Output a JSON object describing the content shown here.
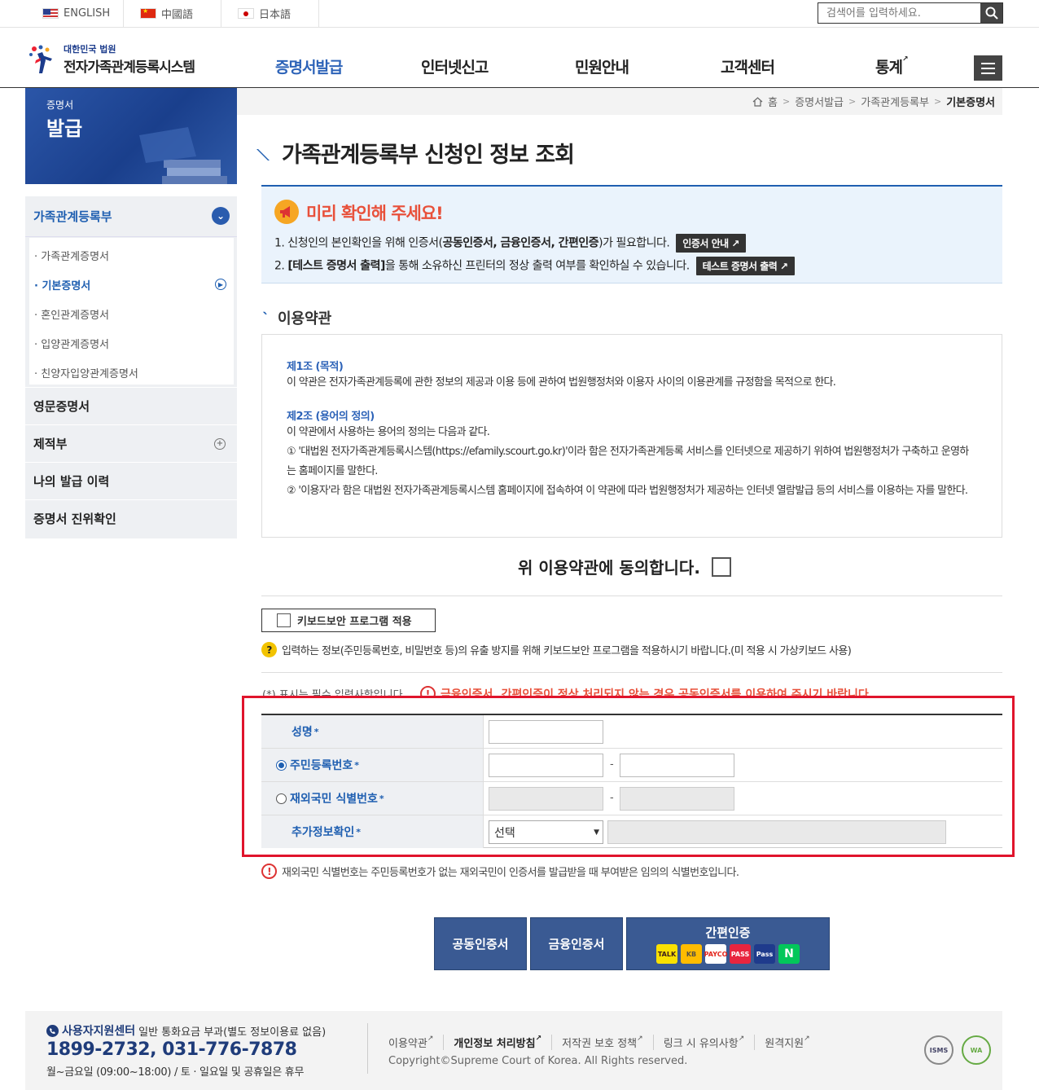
{
  "topbar": {
    "languages": [
      {
        "label": "ENGLISH",
        "flag": "us-flag-icon"
      },
      {
        "label": "中國語",
        "flag": "cn-flag-icon"
      },
      {
        "label": "日本語",
        "flag": "jp-flag-icon"
      }
    ],
    "search_placeholder": "검색어를 입력하세요."
  },
  "header": {
    "logo_sub": "대한민국 법원",
    "logo_main": "전자가족관계등록시스템",
    "nav": [
      "증명서발급",
      "인터넷신고",
      "민원안내",
      "고객센터",
      "통계"
    ],
    "active_nav": "증명서발급"
  },
  "lnb": {
    "banner_small": "증명서",
    "banner_big": "발급",
    "section": "가족관계등록부",
    "sub_items": [
      "가족관계증명서",
      "기본증명서",
      "혼인관계증명서",
      "입양관계증명서",
      "친양자입양관계증명서"
    ],
    "active_sub": "기본증명서",
    "menus": [
      "영문증명서",
      "제적부",
      "나의 발급 이력",
      "증명서 진위확인"
    ]
  },
  "breadcrumb": [
    "홈",
    "증명서발급",
    "가족관계등록부",
    "기본증명서"
  ],
  "page_title": "가족관계등록부 신청인 정보 조회",
  "notice": {
    "title": "미리 확인해 주세요!",
    "line1_pre": "1. 신청인의 본인확인을 위해 인증서(",
    "line1_bold": "공동인증서, 금융인증서, 간편인증",
    "line1_post": ")가 필요합니다.",
    "line1_btn": "인증서 안내",
    "line2_pre": "2. ",
    "line2_bold": "[테스트 증명서 출력]",
    "line2_post": "을 통해 소유하신 프린터의 정상 출력 여부를 확인하실 수 있습니다.",
    "line2_btn": "테스트 증명서 출력"
  },
  "terms": {
    "heading": "이용약관",
    "art1_title": "제1조 (목적)",
    "art1_body": "이 약관은 전자가족관계등록에 관한 정보의 제공과 이용 등에 관하여 법원행정처와 이용자 사이의 이용관계를 규정함을 목적으로 한다.",
    "art2_title": "제2조 (용어의 정의)",
    "art2_intro": "이 약관에서 사용하는 용어의 정의는 다음과 같다.",
    "art2_item1": "① '대법원 전자가족관계등록시스템(https://efamily.scourt.go.kr)'이라 함은 전자가족관계등록 서비스를 인터넷으로 제공하기 위하여 법원행정처가 구축하고 운영하는 홈페이지를 말한다.",
    "art2_item2": "② '이용자'라 함은 대법원 전자가족관계등록시스템 홈페이지에 접속하여 이 약관에 따라 법원행정처가 제공하는 인터넷 열람발급 등의 서비스를 이용하는 자를 말한다.",
    "agree_label": "위 이용약관에 동의합니다."
  },
  "keyboard": {
    "button_label": "키보드보안 프로그램 적용",
    "note": "입력하는 정보(주민등록번호, 비밀번호 등)의 유출 방지를 위해 키보드보안 프로그램을 적용하시기 바랍니다.(미 적용 시 가상키보드 사용)"
  },
  "form": {
    "required_note": "(*) 표시는 필수 입력사항입니다.",
    "warning": "금융인증서, 간편인증이 정상 처리되지 않는 경우 공동인증서를 이용하여 주시기 바랍니다.",
    "name_label": "성명",
    "rrn_label": "주민등록번호",
    "foreign_label": "재외국민 식별번호",
    "extra_label": "추가정보확인",
    "star": "*",
    "dash": "-",
    "select_value": "선택",
    "foreign_note": "재외국민 식별번호는 주민등록번호가 없는 재외국민이 인증서를 발급받을 때 부여받은 임의의 식별번호입니다."
  },
  "auth": {
    "joint": "공동인증서",
    "financial": "금융인증서",
    "easy": "간편인증",
    "easy_icons": [
      "TALK",
      "KB",
      "PAYCO",
      "PASS",
      "Pass",
      "N"
    ]
  },
  "footer": {
    "center": "사용자지원센터",
    "center_note": "일반 통화요금 부과(별도 정보이용료 없음)",
    "phone": "1899-2732, 031-776-7878",
    "hours": "월~금요일 (09:00~18:00) / 토 · 일요일 및 공휴일은 휴무",
    "links": [
      "이용약관",
      "개인정보 처리방침",
      "저작권 보호 정책",
      "링크 시 유의사항",
      "원격지원"
    ],
    "copyright": "Copyright©Supreme Court of Korea. All Rights reserved.",
    "badges": [
      "ISMS",
      "WA"
    ]
  },
  "colors": {
    "accent": "#1f5fb1",
    "button": "#3a5a93",
    "warning": "#e8503a",
    "highlight": "#e0142c"
  }
}
